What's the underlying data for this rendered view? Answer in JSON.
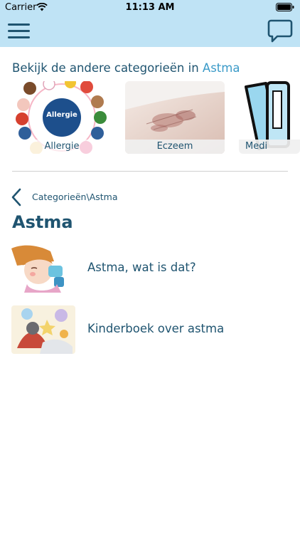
{
  "status": {
    "carrier": "Carrier",
    "time": "11:13 AM"
  },
  "header": {
    "icons": [
      "hamburger-menu-icon",
      "chat-bubble-icon"
    ]
  },
  "categories": {
    "heading_prefix": "Bekijk de andere categorieën in",
    "heading_category": "Astma",
    "items": [
      {
        "label": "Allergie",
        "center_text": "Allergie"
      },
      {
        "label": "Eczeem"
      },
      {
        "label": "Medi"
      }
    ]
  },
  "breadcrumb": {
    "text": "Categorieën\\Astma"
  },
  "page": {
    "title": "Astma"
  },
  "articles": [
    {
      "title": "Astma, wat is dat?"
    },
    {
      "title": "Kinderboek over astma"
    }
  ],
  "colors": {
    "accent": "#3a9ac8",
    "text": "#1f5470",
    "header_bg": "#bfe3f5"
  }
}
